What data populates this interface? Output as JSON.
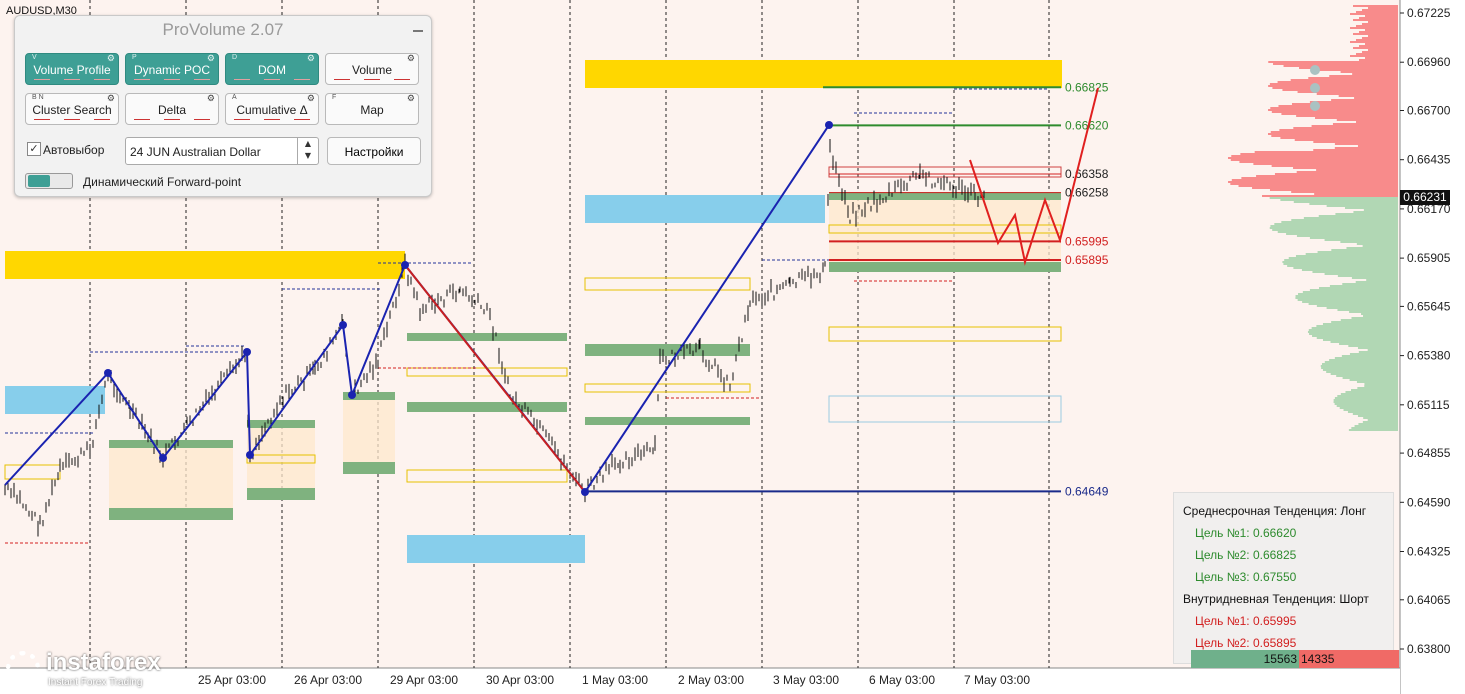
{
  "chart": {
    "symbol": "AUDUSD,M30",
    "current_price": "0.66231",
    "price_axis": [
      "0.67225",
      "0.66960",
      "0.66700",
      "0.66435",
      "0.66170",
      "0.65905",
      "0.65645",
      "0.65380",
      "0.65115",
      "0.64855",
      "0.64590",
      "0.64325",
      "0.64065",
      "0.63800"
    ],
    "time_axis": [
      "25 Apr 03:00",
      "26 Apr 03:00",
      "29 Apr 03:00",
      "30 Apr 03:00",
      "1 May 03:00",
      "2 May 03:00",
      "3 May 03:00",
      "6 May 03:00",
      "7 May 03:00"
    ],
    "levels": [
      {
        "value": "0.66825",
        "color": "#2e8b2e"
      },
      {
        "value": "0.66620",
        "color": "#2e8b2e"
      },
      {
        "value": "0.66358",
        "color": "#222222"
      },
      {
        "value": "0.66258",
        "color": "#222222"
      },
      {
        "value": "0.65995",
        "color": "#d22020"
      },
      {
        "value": "0.65895",
        "color": "#d22020"
      },
      {
        "value": "0.64649",
        "color": "#1a2a8a"
      }
    ],
    "colors": {
      "up_zone": "#ffd700",
      "blue_zone": "#87ceeb",
      "green_zone": "#7fb27f",
      "trend_line": "#1a23b0",
      "target_line": "#e02020"
    }
  },
  "panel": {
    "title": "ProVolume 2.07",
    "buttons": [
      {
        "label": "Volume Profile",
        "key": "V",
        "active": true
      },
      {
        "label": "Dynamic POC",
        "key": "P",
        "active": true
      },
      {
        "label": "DOM",
        "key": "D",
        "active": true
      },
      {
        "label": "Volume",
        "key": "",
        "active": false
      },
      {
        "label": "Cluster Search",
        "key": "B N",
        "active": false
      },
      {
        "label": "Delta",
        "key": "",
        "active": false
      },
      {
        "label": "Cumulative Δ",
        "key": "A",
        "active": false
      },
      {
        "label": "Map",
        "key": "F",
        "active": false
      }
    ],
    "auto_select_label": "Автовыбор",
    "instrument": "24 JUN Australian Dollar",
    "settings_label": "Настройки",
    "forward_point_label": "Динамический Forward-point"
  },
  "trend": {
    "mid_title": "Среднесрочная Тенденция: Лонг",
    "mid_targets": [
      "Цель №1: 0.66620",
      "Цель №2: 0.66825",
      "Цель №3: 0.67550"
    ],
    "intra_title": "Внутридневная Тенденция: Шорт",
    "intra_targets": [
      "Цель №1: 0.65995",
      "Цель №2: 0.65895"
    ],
    "colors": {
      "long": "#2e8b2e",
      "short": "#d22020"
    }
  },
  "volume": {
    "buy": "15563",
    "sell": "14335"
  },
  "logo": {
    "name": "instaforex",
    "tagline": "Instant Forex Trading"
  }
}
